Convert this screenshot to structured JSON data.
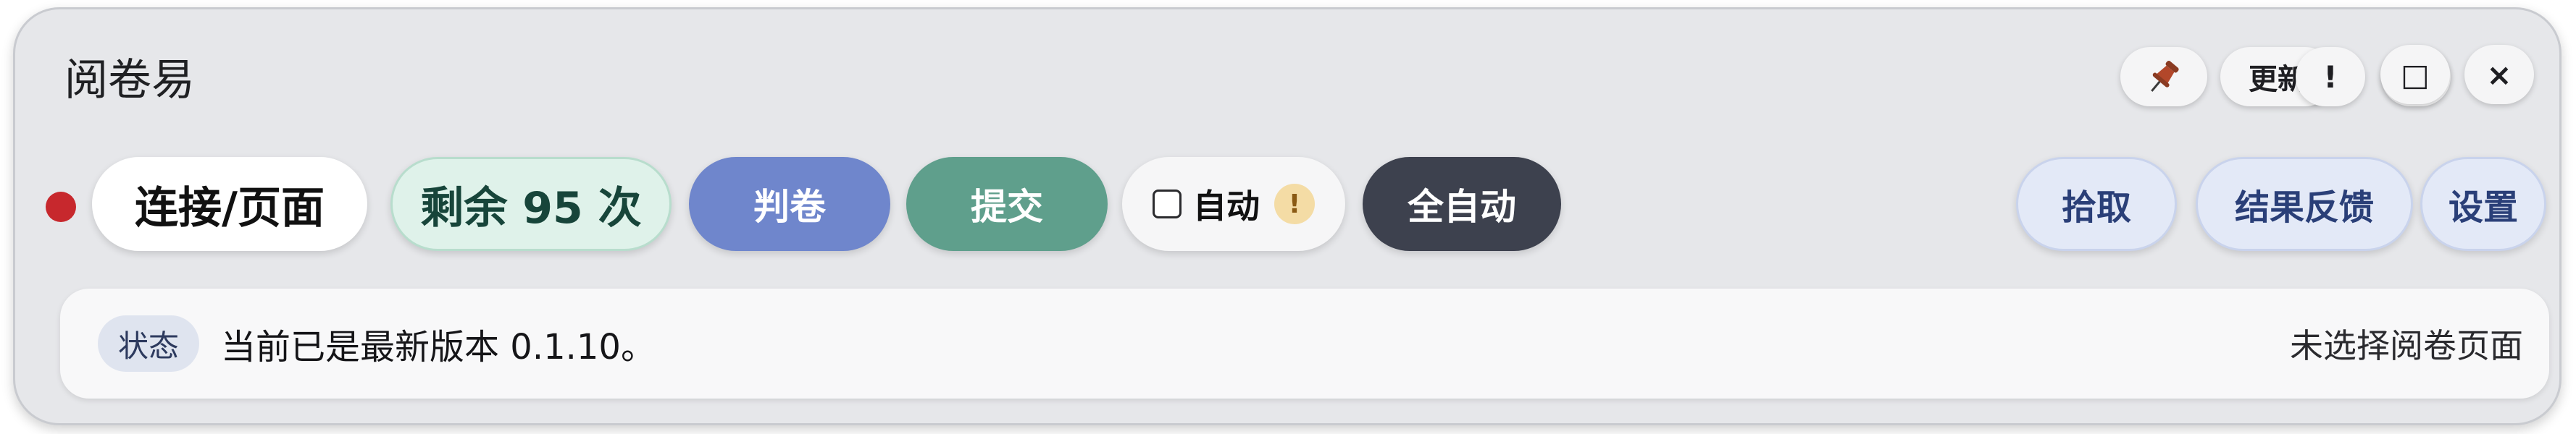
{
  "window": {
    "title": "阅卷易"
  },
  "titlebar": {
    "pin_icon": "pin-icon",
    "update_label": "更新",
    "info_label": "!",
    "minimize_label": "-",
    "maximize_label": "□",
    "close_label": "×"
  },
  "toolbar": {
    "status_dot_color": "#c7282d",
    "connect_label": "连接/页面",
    "remaining_label": "剩余 95 次",
    "judge_label": "判卷",
    "submit_label": "提交",
    "auto_label": "自动",
    "auto_checked": false,
    "auto_warning": "!",
    "full_auto_label": "全自动",
    "pick_label": "拾取",
    "feedback_label": "结果反馈",
    "settings_label": "设置"
  },
  "status": {
    "tag": "状态",
    "message": "当前已是最新版本 0.1.10。",
    "page_state": "未选择阅卷页面"
  },
  "colors": {
    "judge": "#6f86cc",
    "submit": "#5f9f8c",
    "full_auto": "#3d414e",
    "remaining_bg": "#dff2ea"
  }
}
